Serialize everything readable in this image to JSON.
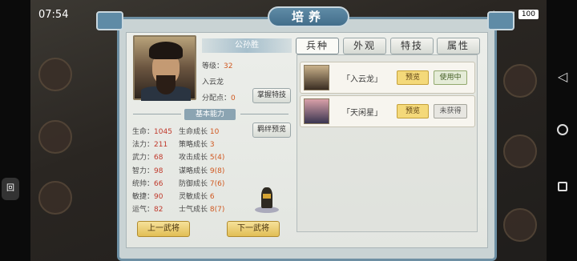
{
  "status_bar": {
    "time": "07:54",
    "battery": "100"
  },
  "panel": {
    "title": "培养"
  },
  "hero": {
    "name": "公孙胜",
    "level_label": "等级：",
    "level_value": "32",
    "title": "入云龙",
    "points_label": "分配点：",
    "points_value": "0",
    "master_skill_button": "掌握特技",
    "section_title": "基本能力",
    "bond_preview_button": "羁绊预览"
  },
  "stats_left": [
    {
      "label": "生命：",
      "value": "1045"
    },
    {
      "label": "法力：",
      "value": "211"
    },
    {
      "label": "武力：",
      "value": "68"
    },
    {
      "label": "智力：",
      "value": "98"
    },
    {
      "label": "统帅：",
      "value": "66"
    },
    {
      "label": "敏捷：",
      "value": "90"
    },
    {
      "label": "运气：",
      "value": "82"
    }
  ],
  "stats_right": [
    {
      "label": "生命成长",
      "value": "10"
    },
    {
      "label": "策略成长",
      "value": "3"
    },
    {
      "label": "攻击成长",
      "value": "5(4)"
    },
    {
      "label": "谋略成长",
      "value": "9(8)"
    },
    {
      "label": "防御成长",
      "value": "7(6)"
    },
    {
      "label": "灵敏成长",
      "value": "6"
    },
    {
      "label": "士气成长",
      "value": "8(7)"
    }
  ],
  "nav_buttons": {
    "prev": "上一武将",
    "next": "下一武将"
  },
  "tabs": [
    {
      "label": "兵种",
      "active": true
    },
    {
      "label": "外观",
      "active": false
    },
    {
      "label": "特技",
      "active": false
    },
    {
      "label": "属性",
      "active": false
    }
  ],
  "unit_cards": [
    {
      "name": "「入云龙」",
      "preview": "预览",
      "status": "使用中",
      "status_type": "using"
    },
    {
      "name": "「天闲星」",
      "preview": "预览",
      "status": "未获得",
      "status_type": "unowned"
    }
  ],
  "colors": {
    "accent_blue": "#5f8ba6",
    "gold_button": "#e1be55",
    "stat_value": "#c0392b",
    "growth_value": "#d05820"
  }
}
